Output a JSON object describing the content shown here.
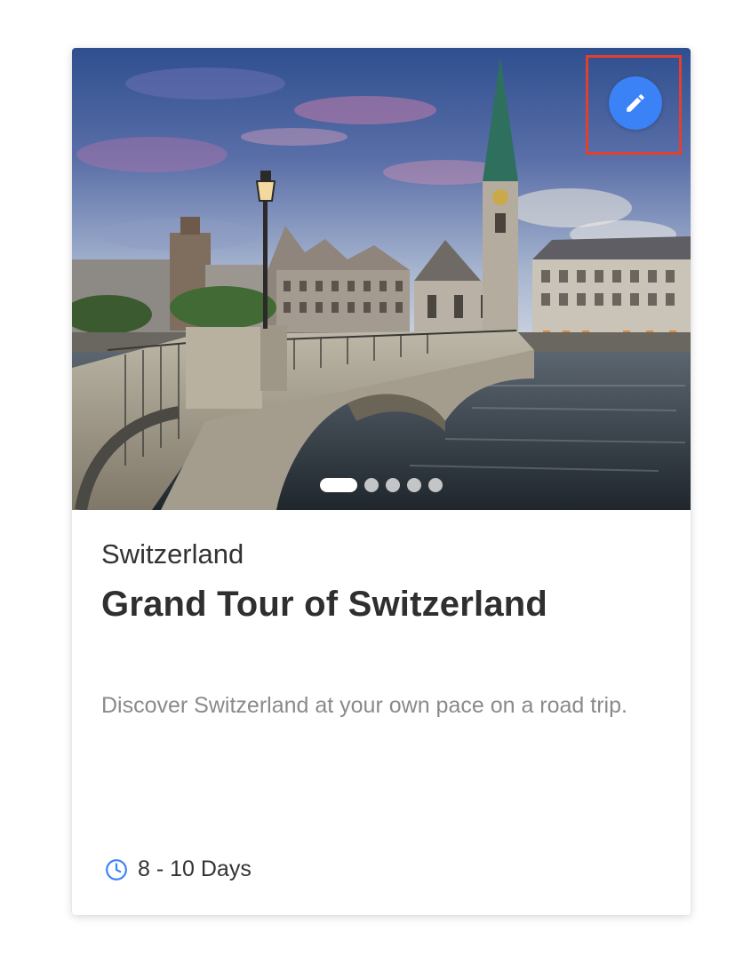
{
  "card": {
    "country": "Switzerland",
    "title": "Grand Tour of Switzerland",
    "description": "Discover Switzerland at your own pace on a road trip.",
    "duration": "8 - 10 Days",
    "duration_icon": "clock-icon",
    "edit_icon": "pencil-icon",
    "image_alt": "Fraumünster church and Münsterbrücke bridge over the Limmat river in Zurich at dusk"
  },
  "carousel": {
    "total": 5,
    "active_index": 1
  },
  "colors": {
    "accent": "#3b82f6",
    "highlight_border": "#e53e2e",
    "title_text": "#2f2f2f",
    "description_text": "#8a8a8a"
  }
}
